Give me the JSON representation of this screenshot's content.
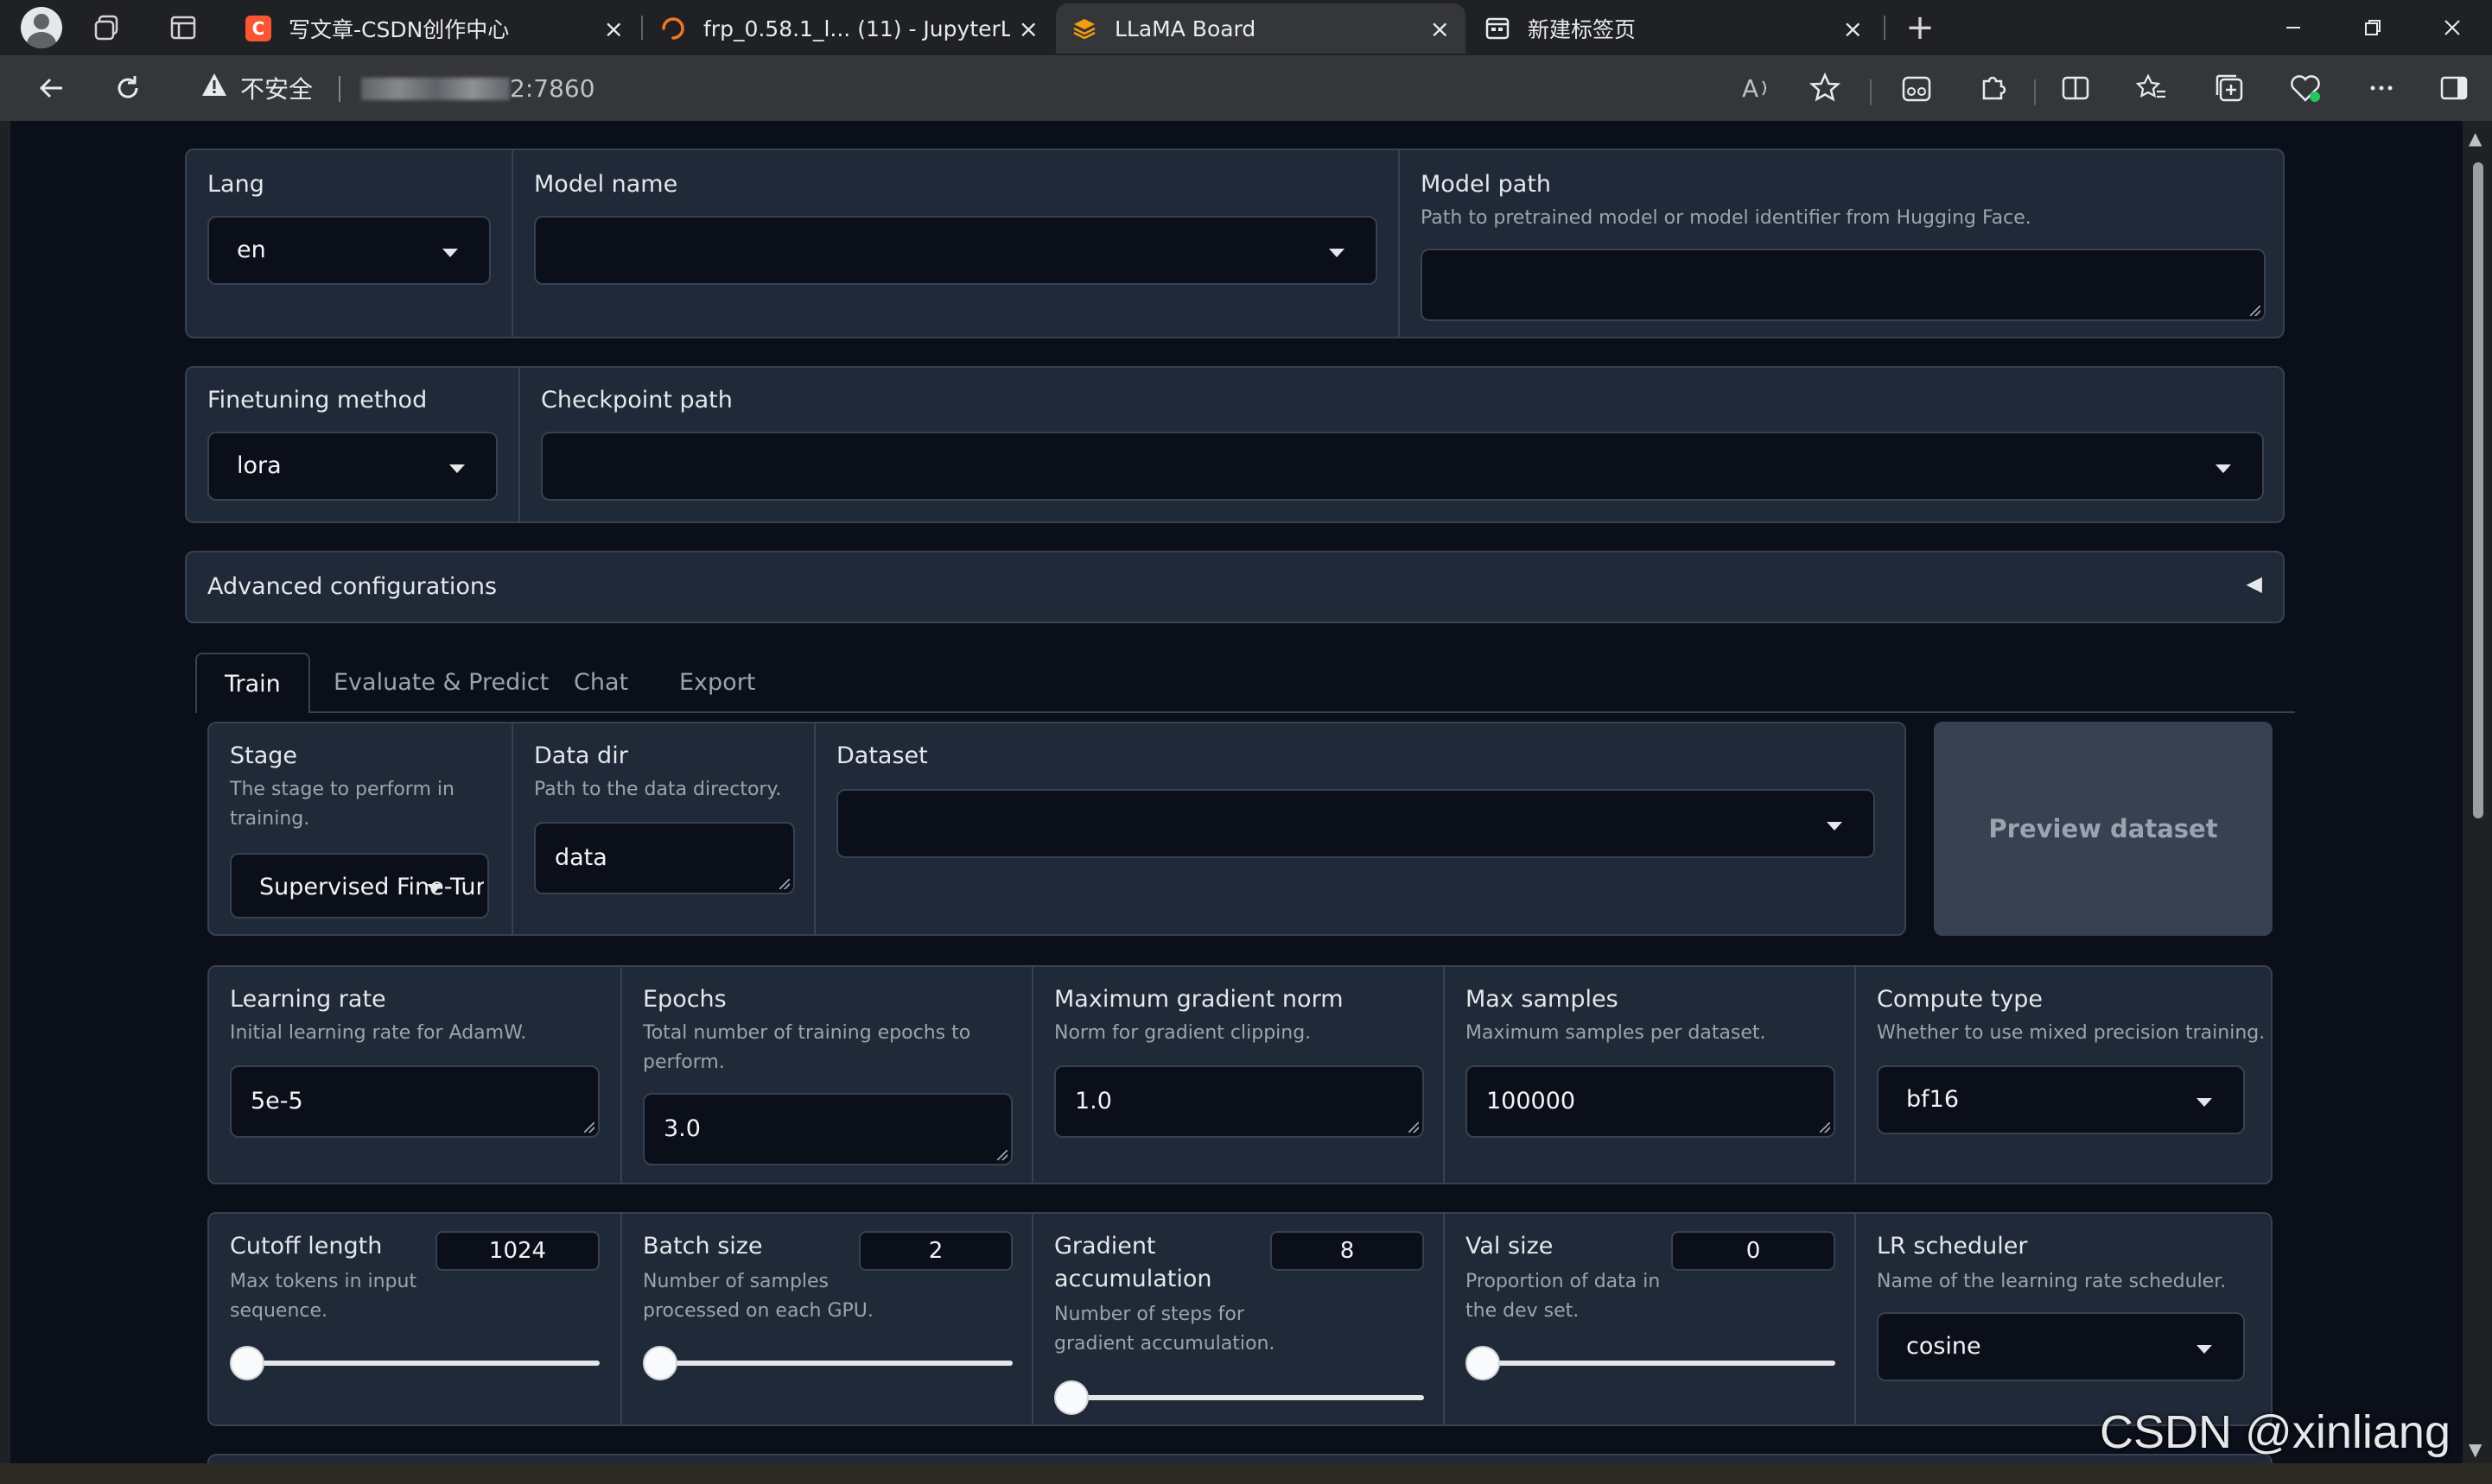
{
  "browser": {
    "tabs": [
      {
        "title": "写文章-CSDN创作中心",
        "icon": "csdn-icon",
        "active": false
      },
      {
        "title": "frp_0.58.1_l... (11) - JupyterLab",
        "icon": "jupyter-loading-icon",
        "active": false
      },
      {
        "title": "LLaMA Board",
        "icon": "llama-board-icon",
        "active": true
      },
      {
        "title": "新建标签页",
        "icon": "new-tab-page-icon",
        "active": false
      }
    ],
    "security_label": "不安全",
    "url_port": "2:7860",
    "new_tab_symbol": "+",
    "close_symbol": "×"
  },
  "top_row": {
    "lang": {
      "label": "Lang",
      "value": "en"
    },
    "model_name": {
      "label": "Model name",
      "value": ""
    },
    "model_path": {
      "label": "Model path",
      "info": "Path to pretrained model or model identifier from Hugging Face.",
      "value": ""
    }
  },
  "second_row": {
    "finetuning_method": {
      "label": "Finetuning method",
      "value": "lora"
    },
    "checkpoint_path": {
      "label": "Checkpoint path",
      "value": ""
    }
  },
  "advanced": {
    "label": "Advanced configurations",
    "arrow": "◀"
  },
  "main_tabs": [
    "Train",
    "Evaluate & Predict",
    "Chat",
    "Export"
  ],
  "train": {
    "stage": {
      "label": "Stage",
      "info_1": "The stage to perform in",
      "info_2": "training.",
      "value": "Supervised Fine-Tur"
    },
    "data_dir": {
      "label": "Data dir",
      "info": "Path to the data directory.",
      "value": "data"
    },
    "dataset": {
      "label": "Dataset",
      "value": ""
    },
    "preview_button": "Preview dataset",
    "learning_rate": {
      "label": "Learning rate",
      "info": "Initial learning rate for AdamW.",
      "value": "5e-5"
    },
    "epochs": {
      "label": "Epochs",
      "info_1": "Total number of training epochs to",
      "info_2": "perform.",
      "value": "3.0"
    },
    "max_grad_norm": {
      "label": "Maximum gradient norm",
      "info": "Norm for gradient clipping.",
      "value": "1.0"
    },
    "max_samples": {
      "label": "Max samples",
      "info": "Maximum samples per dataset.",
      "value": "100000"
    },
    "compute_type": {
      "label": "Compute type",
      "info": "Whether to use mixed precision training.",
      "value": "bf16"
    },
    "cutoff_len": {
      "label": "Cutoff length",
      "info_1": "Max tokens in input",
      "info_2": "sequence.",
      "value": "1024",
      "slider_fraction": 0.0
    },
    "batch_size": {
      "label": "Batch size",
      "info_1": "Number of samples",
      "info_2": "processed on each GPU.",
      "value": "2",
      "slider_fraction": 0.0
    },
    "grad_accum": {
      "label_1": "Gradient",
      "label_2": "accumulation",
      "info_1": "Number of steps for",
      "info_2": "gradient accumulation.",
      "value": "8",
      "slider_fraction": 0.0
    },
    "val_size": {
      "label": "Val size",
      "info_1": "Proportion of data in",
      "info_2": "the dev set.",
      "value": "0",
      "slider_fraction": 0.0
    },
    "lr_scheduler": {
      "label": "LR scheduler",
      "info": "Name of the learning rate scheduler.",
      "value": "cosine"
    }
  },
  "watermark": "CSDN @xinliang",
  "colors": {
    "page_bg": "#0b0f19",
    "panel_bg": "#1f2937",
    "border": "#374151",
    "csdn_red": "#fc5531",
    "llama_orange": "#f59e0b"
  }
}
